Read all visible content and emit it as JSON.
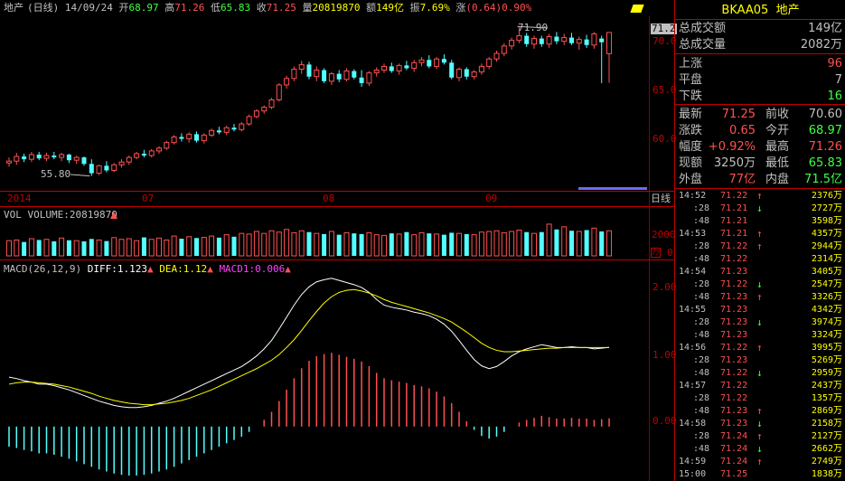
{
  "header": {
    "name": "地产",
    "period": "(日线)",
    "date": "14/09/24",
    "open_label": "开",
    "open": "68.97",
    "high_label": "高",
    "high": "71.26",
    "low_label": "低",
    "low": "65.83",
    "close_label": "收",
    "close": "71.25",
    "vol_label": "量",
    "vol": "20819870",
    "amount_label": "额",
    "amount": "149亿",
    "amp_label": "振",
    "amp": "7.69%",
    "chg_label": "涨",
    "chg": "(0.64)0.90%"
  },
  "price_axis": {
    "ticks": [
      "70.0",
      "65.0",
      "60.0"
    ],
    "current": "71.2"
  },
  "annotations": {
    "high_mark": "71.90",
    "low_mark": "55.80"
  },
  "date_axis": {
    "labels": [
      "2014",
      "07",
      "08",
      "09"
    ],
    "period_button": "日线"
  },
  "vol_panel": {
    "title": "VOL VOLUME:20819870",
    "tick": "2000",
    "zero": "0",
    "unit": "万"
  },
  "macd_panel": {
    "title": "MACD(26,12,9)",
    "diff_label": "DIFF:1.123",
    "dea_label": "DEA:1.12",
    "macd_label": "MACD1:0.006",
    "ticks": [
      "2.00",
      "1.00",
      "0.00"
    ]
  },
  "colors": {
    "up": "#ff5050",
    "down": "#54ffff",
    "diff": "#ffffff",
    "dea": "#ffff00",
    "macd": "#ff40ff",
    "grid": "#8b0000"
  },
  "side": {
    "code": "BKAA05",
    "name": "地产",
    "stats": [
      {
        "label": "总成交额",
        "value": "149亿"
      },
      {
        "label": "总成交量",
        "value": "2082万"
      }
    ],
    "breadth": [
      {
        "label": "上涨",
        "value": "96",
        "color": "#ff5050"
      },
      {
        "label": "平盘",
        "value": "7",
        "color": "#c0c0c0"
      },
      {
        "label": "下跌",
        "value": "16",
        "color": "#40ff40"
      }
    ],
    "quote": [
      {
        "l1": "最新",
        "v1": "71.25",
        "c1": "#ff5050",
        "l2": "前收",
        "v2": "70.60",
        "c2": "#c0c0c0"
      },
      {
        "l1": "涨跌",
        "v1": "0.65",
        "c1": "#ff5050",
        "l2": "今开",
        "v2": "68.97",
        "c2": "#40ff40"
      },
      {
        "l1": "幅度",
        "v1": "+0.92%",
        "c1": "#ff5050",
        "l2": "最高",
        "v2": "71.26",
        "c2": "#ff5050"
      },
      {
        "l1": "现额",
        "v1": "3250万",
        "c1": "#c0c0c0",
        "l2": "最低",
        "v2": "65.83",
        "c2": "#40ff40"
      },
      {
        "l1": "外盘",
        "v1": "77亿",
        "c1": "#ff5050",
        "l2": "内盘",
        "v2": "71.5亿",
        "c2": "#40ff40"
      }
    ],
    "ticks": [
      {
        "time": "14:52",
        "price": "71.22",
        "dir": "up",
        "vol": "2376万"
      },
      {
        "time": ":28",
        "price": "71.21",
        "dir": "down",
        "vol": "2727万"
      },
      {
        "time": ":48",
        "price": "71.21",
        "dir": "",
        "vol": "3598万"
      },
      {
        "time": "14:53",
        "price": "71.21",
        "dir": "up",
        "vol": "4357万"
      },
      {
        "time": ":28",
        "price": "71.22",
        "dir": "up",
        "vol": "2944万"
      },
      {
        "time": ":48",
        "price": "71.22",
        "dir": "",
        "vol": "2314万"
      },
      {
        "time": "14:54",
        "price": "71.23",
        "dir": "",
        "vol": "3405万"
      },
      {
        "time": ":28",
        "price": "71.22",
        "dir": "down",
        "vol": "2547万"
      },
      {
        "time": ":48",
        "price": "71.23",
        "dir": "up",
        "vol": "3326万"
      },
      {
        "time": "14:55",
        "price": "71.23",
        "dir": "",
        "vol": "4342万"
      },
      {
        "time": ":28",
        "price": "71.23",
        "dir": "down",
        "vol": "3974万"
      },
      {
        "time": ":48",
        "price": "71.23",
        "dir": "",
        "vol": "3324万"
      },
      {
        "time": "14:56",
        "price": "71.22",
        "dir": "up",
        "vol": "3995万"
      },
      {
        "time": ":28",
        "price": "71.23",
        "dir": "",
        "vol": "5269万"
      },
      {
        "time": ":48",
        "price": "71.22",
        "dir": "down",
        "vol": "2959万"
      },
      {
        "time": "14:57",
        "price": "71.22",
        "dir": "",
        "vol": "2437万"
      },
      {
        "time": ":28",
        "price": "71.22",
        "dir": "",
        "vol": "1357万"
      },
      {
        "time": ":48",
        "price": "71.23",
        "dir": "up",
        "vol": "2869万"
      },
      {
        "time": "14:58",
        "price": "71.23",
        "dir": "down",
        "vol": "2158万"
      },
      {
        "time": ":28",
        "price": "71.24",
        "dir": "up",
        "vol": "2127万"
      },
      {
        "time": ":48",
        "price": "71.24",
        "dir": "down",
        "vol": "2662万"
      },
      {
        "time": "14:59",
        "price": "71.24",
        "dir": "up",
        "vol": "2749万"
      },
      {
        "time": "15:00",
        "price": "71.25",
        "dir": "",
        "vol": "1838万"
      }
    ]
  },
  "chart_data": {
    "type": "candlestick",
    "candles": [
      [
        57.2,
        57.8,
        56.8,
        57.4
      ],
      [
        57.4,
        58.3,
        57.0,
        57.9
      ],
      [
        57.9,
        58.2,
        57.3,
        57.6
      ],
      [
        57.6,
        58.4,
        57.3,
        58.1
      ],
      [
        58.1,
        58.4,
        57.5,
        57.7
      ],
      [
        57.7,
        58.3,
        57.4,
        58.0
      ],
      [
        58.0,
        58.4,
        57.6,
        57.8
      ],
      [
        57.8,
        58.3,
        57.4,
        58.1
      ],
      [
        58.1,
        58.2,
        57.2,
        57.5
      ],
      [
        57.5,
        58.0,
        57.1,
        57.8
      ],
      [
        57.8,
        57.9,
        56.9,
        57.1
      ],
      [
        57.1,
        57.6,
        55.8,
        56.1
      ],
      [
        56.1,
        57.0,
        55.9,
        56.9
      ],
      [
        56.9,
        57.4,
        56.2,
        56.4
      ],
      [
        56.4,
        57.2,
        56.2,
        57.0
      ],
      [
        57.0,
        57.6,
        56.7,
        57.3
      ],
      [
        57.3,
        58.0,
        57.0,
        57.8
      ],
      [
        57.8,
        58.4,
        57.6,
        58.2
      ],
      [
        58.2,
        58.6,
        57.8,
        58.0
      ],
      [
        58.0,
        58.7,
        57.8,
        58.5
      ],
      [
        58.5,
        59.0,
        58.2,
        58.8
      ],
      [
        58.8,
        59.6,
        58.6,
        59.4
      ],
      [
        59.4,
        60.2,
        59.2,
        60.0
      ],
      [
        60.0,
        60.4,
        59.5,
        59.8
      ],
      [
        59.8,
        60.5,
        59.4,
        60.3
      ],
      [
        60.3,
        60.6,
        59.4,
        59.6
      ],
      [
        59.6,
        60.4,
        59.3,
        60.2
      ],
      [
        60.2,
        60.9,
        60.0,
        60.7
      ],
      [
        60.7,
        61.1,
        60.3,
        60.5
      ],
      [
        60.5,
        61.2,
        60.2,
        61.0
      ],
      [
        61.0,
        61.4,
        60.6,
        60.8
      ],
      [
        60.8,
        61.6,
        60.6,
        61.4
      ],
      [
        61.4,
        62.4,
        61.2,
        62.2
      ],
      [
        62.2,
        63.0,
        62.0,
        62.8
      ],
      [
        62.8,
        63.4,
        62.5,
        63.2
      ],
      [
        63.2,
        64.2,
        63.0,
        64.0
      ],
      [
        64.0,
        65.8,
        63.8,
        65.6
      ],
      [
        65.6,
        66.6,
        65.2,
        66.3
      ],
      [
        66.3,
        67.6,
        66.0,
        67.3
      ],
      [
        67.3,
        68.2,
        66.8,
        67.8
      ],
      [
        67.8,
        68.1,
        66.2,
        66.5
      ],
      [
        66.5,
        67.6,
        66.0,
        67.2
      ],
      [
        67.2,
        67.4,
        65.8,
        66.0
      ],
      [
        66.0,
        67.0,
        65.6,
        66.8
      ],
      [
        66.8,
        67.2,
        65.9,
        66.2
      ],
      [
        66.2,
        67.4,
        66.0,
        67.1
      ],
      [
        67.1,
        67.3,
        66.2,
        66.4
      ],
      [
        66.4,
        67.2,
        65.4,
        65.8
      ],
      [
        65.8,
        67.1,
        65.5,
        66.9
      ],
      [
        66.9,
        67.5,
        66.5,
        67.2
      ],
      [
        67.2,
        67.9,
        66.9,
        67.6
      ],
      [
        67.6,
        68.0,
        66.9,
        67.1
      ],
      [
        67.1,
        67.9,
        66.7,
        67.7
      ],
      [
        67.7,
        68.2,
        67.2,
        67.4
      ],
      [
        67.4,
        68.3,
        67.0,
        68.0
      ],
      [
        68.0,
        68.6,
        67.6,
        68.3
      ],
      [
        68.3,
        68.8,
        67.4,
        67.6
      ],
      [
        67.6,
        68.6,
        67.3,
        68.4
      ],
      [
        68.4,
        68.9,
        67.8,
        68.0
      ],
      [
        68.0,
        68.3,
        66.2,
        66.4
      ],
      [
        66.4,
        67.5,
        66.0,
        67.3
      ],
      [
        67.3,
        67.5,
        66.2,
        66.5
      ],
      [
        66.5,
        67.2,
        66.2,
        67.0
      ],
      [
        67.0,
        67.9,
        66.7,
        67.6
      ],
      [
        67.6,
        68.6,
        67.3,
        68.4
      ],
      [
        68.4,
        69.3,
        68.1,
        69.0
      ],
      [
        69.0,
        70.1,
        68.7,
        69.8
      ],
      [
        69.8,
        70.7,
        69.4,
        70.4
      ],
      [
        70.4,
        71.9,
        70.1,
        70.9
      ],
      [
        70.9,
        71.2,
        69.7,
        70.0
      ],
      [
        70.0,
        70.9,
        69.5,
        70.6
      ],
      [
        70.6,
        70.9,
        69.7,
        70.0
      ],
      [
        70.0,
        71.1,
        69.6,
        70.8
      ],
      [
        70.8,
        71.3,
        70.0,
        70.3
      ],
      [
        70.3,
        71.1,
        69.9,
        70.7
      ],
      [
        70.7,
        71.2,
        69.9,
        70.1
      ],
      [
        70.1,
        70.8,
        69.4,
        70.5
      ],
      [
        70.5,
        71.0,
        69.6,
        69.9
      ],
      [
        69.9,
        71.3,
        69.5,
        71.1
      ],
      [
        70.6,
        70.9,
        65.8,
        70.2
      ],
      [
        68.97,
        71.26,
        65.83,
        71.25
      ]
    ],
    "volume": [
      1150,
      1200,
      1050,
      1300,
      1200,
      1250,
      1100,
      1350,
      1180,
      1150,
      1100,
      1280,
      1200,
      1120,
      1380,
      1250,
      1300,
      1150,
      1400,
      1250,
      1350,
      1200,
      1500,
      1300,
      1450,
      1350,
      1400,
      1500,
      1380,
      1600,
      1450,
      1700,
      1650,
      1850,
      1700,
      1900,
      1800,
      2000,
      1750,
      1900,
      1800,
      1700,
      1650,
      1850,
      1600,
      1750,
      1700,
      1650,
      1750,
      1600,
      1550,
      1700,
      1650,
      1800,
      1600,
      1750,
      1700,
      1650,
      1600,
      1750,
      1700,
      1650,
      1600,
      1800,
      1850,
      1900,
      1750,
      1850,
      1950,
      1800,
      1700,
      1800,
      2400,
      2000,
      2200,
      1900,
      1850,
      1950,
      2100,
      1850,
      1900
    ],
    "diff": [
      0.7,
      0.68,
      0.65,
      0.63,
      0.6,
      0.6,
      0.58,
      0.55,
      0.52,
      0.48,
      0.44,
      0.4,
      0.36,
      0.33,
      0.3,
      0.28,
      0.27,
      0.27,
      0.28,
      0.3,
      0.33,
      0.36,
      0.4,
      0.45,
      0.5,
      0.55,
      0.6,
      0.65,
      0.7,
      0.75,
      0.8,
      0.85,
      0.92,
      1.0,
      1.1,
      1.22,
      1.38,
      1.55,
      1.72,
      1.87,
      1.98,
      2.05,
      2.08,
      2.1,
      2.07,
      2.04,
      2.01,
      1.97,
      1.9,
      1.8,
      1.72,
      1.69,
      1.67,
      1.65,
      1.62,
      1.6,
      1.57,
      1.52,
      1.45,
      1.35,
      1.22,
      1.08,
      0.95,
      0.86,
      0.82,
      0.85,
      0.92,
      1.0,
      1.06,
      1.1,
      1.13,
      1.16,
      1.14,
      1.12,
      1.12,
      1.13,
      1.12,
      1.12,
      1.1,
      1.11,
      1.123
    ],
    "dea": [
      0.6,
      0.62,
      0.63,
      0.63,
      0.62,
      0.61,
      0.6,
      0.58,
      0.56,
      0.53,
      0.5,
      0.47,
      0.43,
      0.4,
      0.37,
      0.35,
      0.33,
      0.32,
      0.31,
      0.31,
      0.32,
      0.33,
      0.35,
      0.37,
      0.4,
      0.44,
      0.48,
      0.52,
      0.57,
      0.62,
      0.67,
      0.72,
      0.77,
      0.82,
      0.88,
      0.94,
      1.02,
      1.12,
      1.23,
      1.36,
      1.5,
      1.63,
      1.75,
      1.84,
      1.9,
      1.93,
      1.94,
      1.92,
      1.89,
      1.85,
      1.8,
      1.76,
      1.73,
      1.7,
      1.67,
      1.64,
      1.61,
      1.57,
      1.53,
      1.48,
      1.41,
      1.34,
      1.26,
      1.18,
      1.12,
      1.08,
      1.06,
      1.06,
      1.07,
      1.08,
      1.09,
      1.1,
      1.11,
      1.11,
      1.12,
      1.12,
      1.12,
      1.12,
      1.12,
      1.12,
      1.12
    ],
    "price_range": [
      54.5,
      72.8
    ],
    "macd_range": [
      -0.72,
      2.2
    ],
    "vol_max": 2600
  }
}
